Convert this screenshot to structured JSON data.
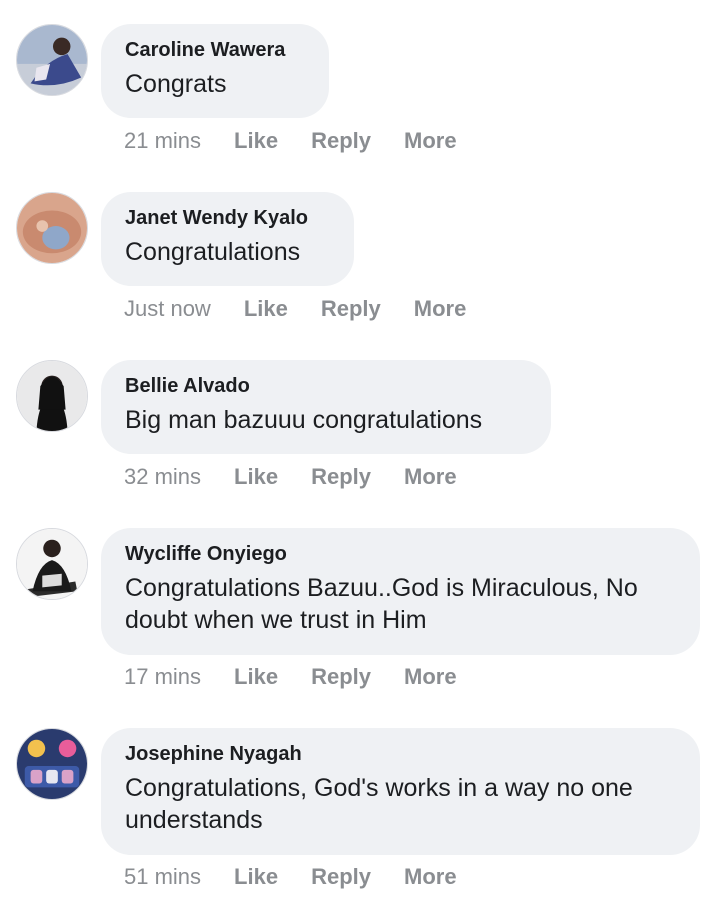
{
  "comments": [
    {
      "author": "Caroline Wawera",
      "text": "Congrats",
      "time": "21 mins"
    },
    {
      "author": "Janet Wendy Kyalo",
      "text": "Congratulations",
      "time": "Just now"
    },
    {
      "author": "Bellie Alvado",
      "text": "Big man bazuuu congratulations",
      "time": "32 mins"
    },
    {
      "author": "Wycliffe Onyiego",
      "text": "Congratulations Bazuu..God is Miraculous, No doubt when we trust in Him",
      "time": "17 mins"
    },
    {
      "author": "Josephine Nyagah",
      "text": "Congratulations, God's works in a way no one understands",
      "time": "51 mins"
    }
  ],
  "actions": {
    "like": "Like",
    "reply": "Reply",
    "more": "More"
  },
  "colors": {
    "bubble": "#eff1f4",
    "meta": "#8a8d91",
    "text": "#1c1e21"
  }
}
